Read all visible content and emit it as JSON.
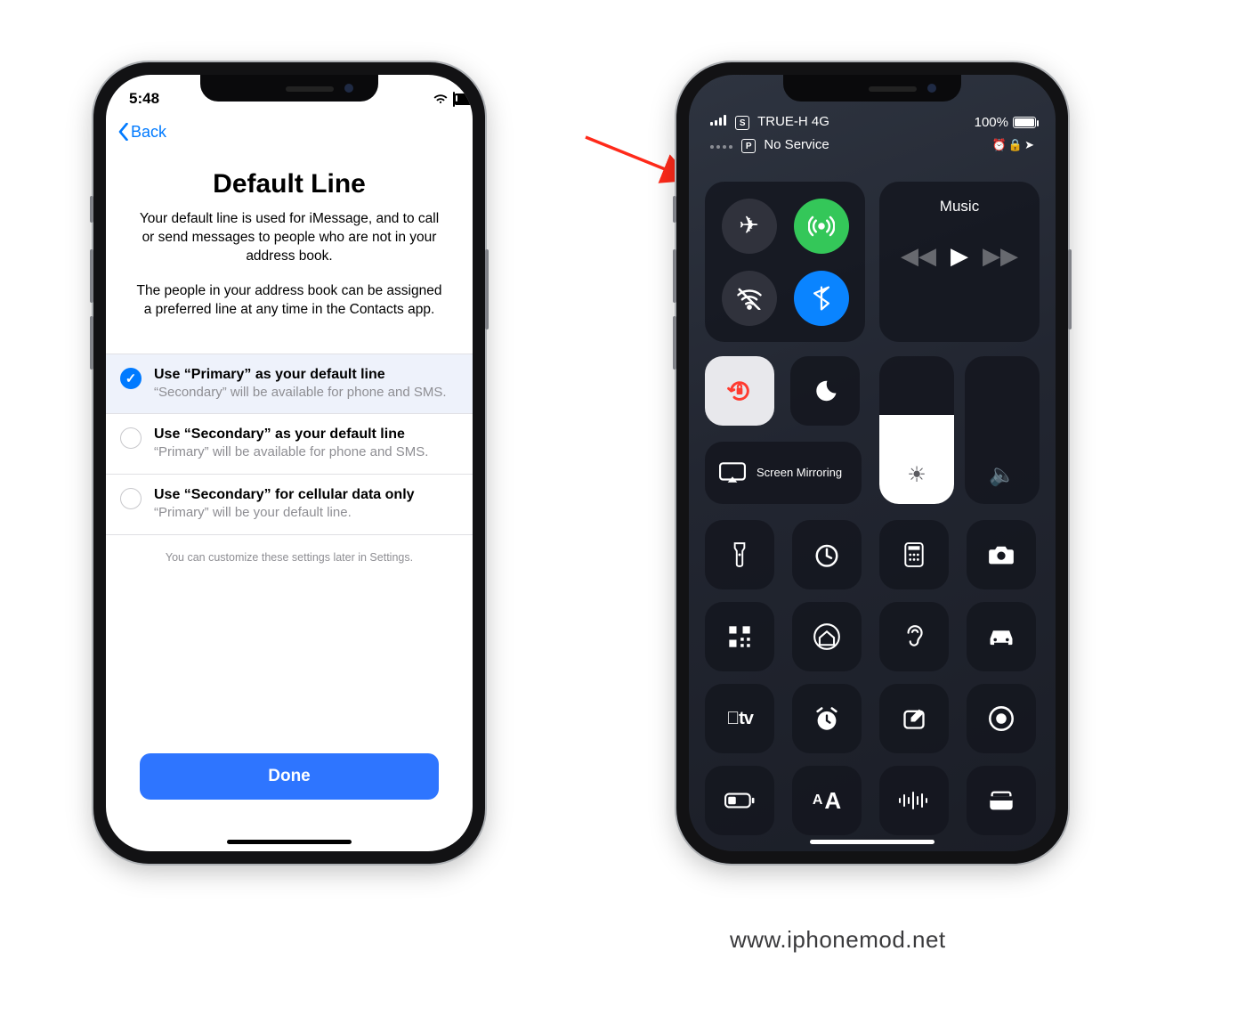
{
  "left_phone": {
    "status": {
      "time": "5:48"
    },
    "nav": {
      "back_label": "Back"
    },
    "title": "Default Line",
    "description1": "Your default line is used for iMessage, and to call or send messages to people who are not in your address book.",
    "description2": "The people in your address book can be assigned a preferred line at any time in the Contacts app.",
    "options": [
      {
        "title": "Use “Primary” as your default line",
        "subtitle": "“Secondary” will be available for phone and SMS.",
        "selected": true
      },
      {
        "title": "Use “Secondary” as your default line",
        "subtitle": "“Primary” will be available for phone and SMS.",
        "selected": false
      },
      {
        "title": "Use “Secondary” for cellular data only",
        "subtitle": "“Primary” will be your default line.",
        "selected": false
      }
    ],
    "footnote": "You can customize these settings later in Settings.",
    "done_label": "Done"
  },
  "right_phone": {
    "sim1": {
      "tag": "S",
      "carrier": "TRUE-H 4G",
      "signal": 4
    },
    "sim2": {
      "tag": "P",
      "carrier": "No Service",
      "signal": 0
    },
    "battery": {
      "text": "100%",
      "level": 100
    },
    "status_icons": [
      "alarm-icon",
      "lock-icon",
      "location-icon"
    ],
    "music_title": "Music",
    "brightness_percent": 60,
    "volume_percent": 0,
    "connectivity": {
      "airplane": {
        "on": false
      },
      "cellular": {
        "on": true
      },
      "wifi": {
        "on": false
      },
      "bluetooth": {
        "on": true
      }
    },
    "orientation_lock_on": true,
    "dnd_on": false,
    "screen_mirroring_label": "Screen Mirroring",
    "shortcut_icons": [
      "flashlight-icon",
      "timer-icon",
      "calculator-icon",
      "camera-icon",
      "qr-icon",
      "home-icon",
      "hearing-icon",
      "car-icon",
      "apple-tv-icon",
      "alarm-clock-icon",
      "note-icon",
      "record-icon",
      "low-power-icon",
      "text-size-icon",
      "voice-memo-icon",
      "wallet-icon"
    ],
    "apple_tv_label": "tv"
  },
  "watermark": "www.iphonemod.net"
}
